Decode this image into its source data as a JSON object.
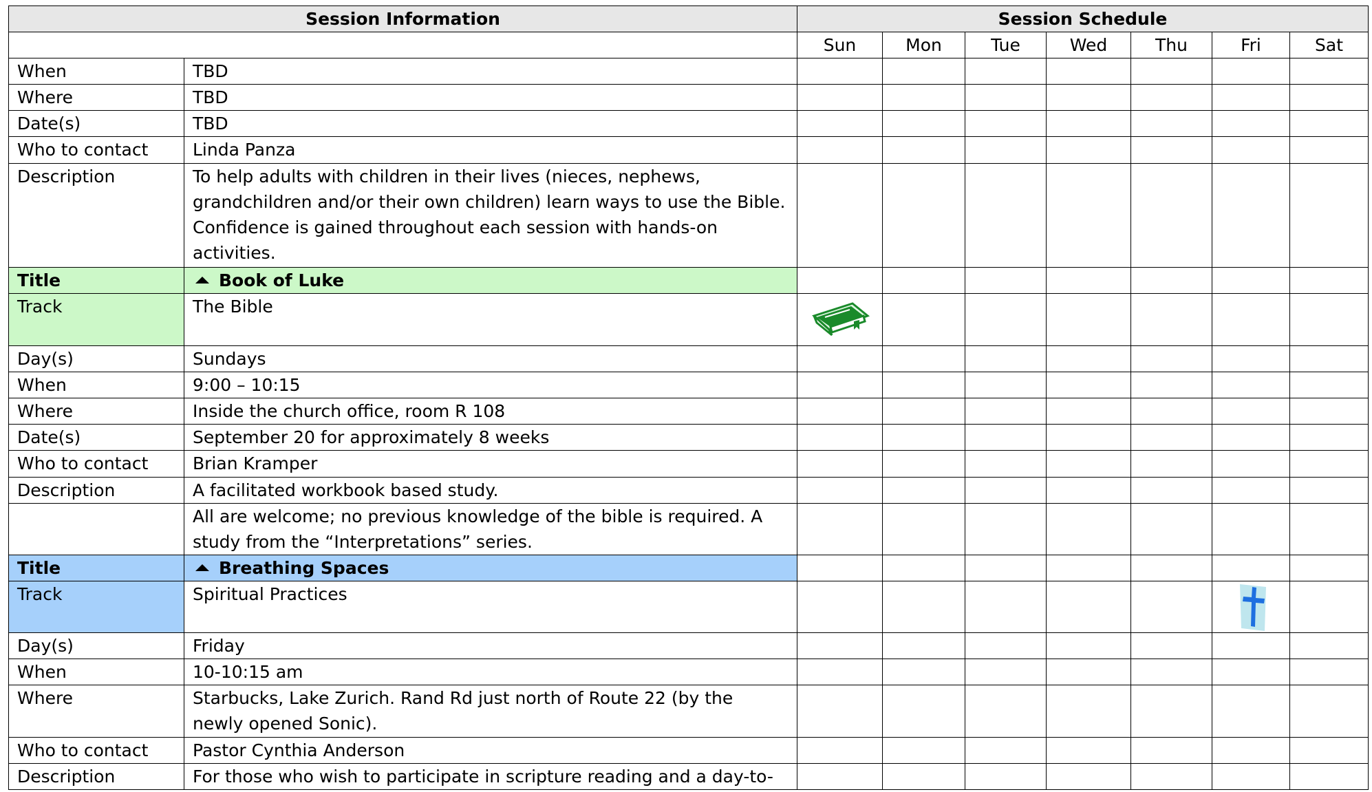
{
  "headers": {
    "session_info": "Session Information",
    "session_schedule": "Session Schedule",
    "days": [
      "Sun",
      "Mon",
      "Tue",
      "Wed",
      "Thu",
      "Fri",
      "Sat"
    ]
  },
  "intro": {
    "when_label": "When",
    "when": "TBD",
    "where_label": "Where",
    "where": "TBD",
    "dates_label": "Date(s)",
    "dates": "TBD",
    "contact_label": "Who to contact",
    "contact": "Linda Panza",
    "desc_label": "Description",
    "desc_lines": [
      "To help adults with children in their lives (nieces, nephews,",
      "grandchildren and/or their own children) learn ways to use the Bible.",
      "Confidence is gained throughout each session with hands-on",
      "activities."
    ]
  },
  "session1": {
    "title_label": "Title",
    "title": "Book of Luke",
    "track_label": "Track",
    "track": "The Bible",
    "days_label": "Day(s)",
    "days": "Sundays",
    "when_label": "When",
    "when": "9:00 – 10:15",
    "where_label": "Where",
    "where": "Inside the church office, room R 108",
    "dates_label": "Date(s)",
    "dates": "September 20 for approximately 8 weeks",
    "contact_label": "Who to contact",
    "contact": "Brian Kramper",
    "desc_label": "Description",
    "desc": "A facilitated workbook based study.",
    "desc2_lines": [
      "All are welcome; no previous knowledge of the bible is required. A",
      "study from the “Interpretations” series."
    ],
    "icon": "bible-book-icon",
    "icon_color": "#1a8a2a"
  },
  "session2": {
    "title_label": "Title",
    "title": "Breathing Spaces",
    "track_label": "Track",
    "track": "Spiritual Practices",
    "days_label": "Day(s)",
    "days": "Friday",
    "when_label": "When",
    "when": "10-10:15 am",
    "where_label": "Where",
    "where_lines": [
      "Starbucks, Lake Zurich. Rand Rd just north of Route 22 (by the",
      "newly opened Sonic)."
    ],
    "contact_label": "Who to contact",
    "contact": "Pastor Cynthia Anderson",
    "desc_label": "Description",
    "desc_line1": "For those who wish to participate in scripture reading and a day-to-",
    "icon": "cross-icon",
    "icon_color": "#1e6fe0"
  },
  "colors": {
    "header_bg": "#e7e7e7",
    "session1_accent": "#ccf8c8",
    "session2_accent": "#a6d0fb"
  }
}
